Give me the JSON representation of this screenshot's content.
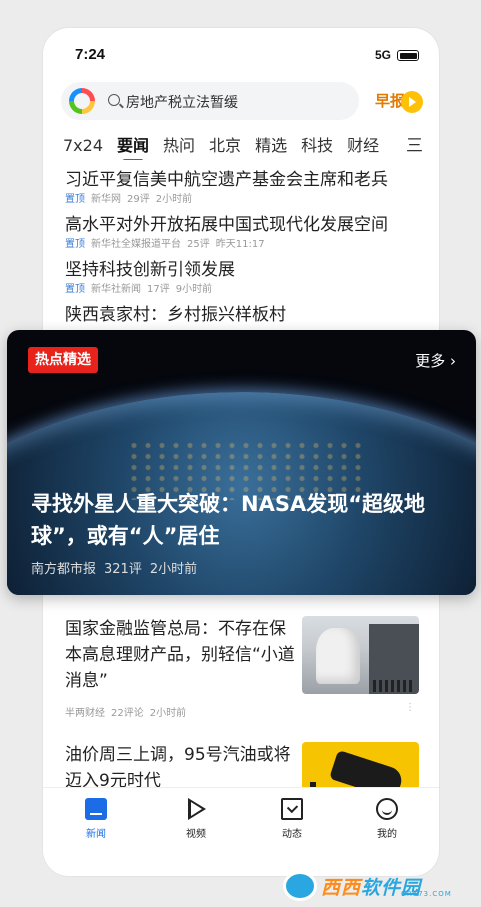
{
  "status_bar": {
    "time": "7:24",
    "network": "5G"
  },
  "search": {
    "query": "房地产税立法暂缓",
    "zaobao_label": "早报"
  },
  "tabs": [
    "7x24",
    "要闻",
    "热问",
    "北京",
    "精选",
    "科技",
    "财经"
  ],
  "active_tab": "要闻",
  "tab_menu_glyph": "三",
  "news": [
    {
      "title": "习近平复信美中航空遗产基金会主席和老兵",
      "pin": "置顶",
      "source": "新华网",
      "comments": "29评",
      "time": "2小时前"
    },
    {
      "title": "高水平对外开放拓展中国式现代化发展空间",
      "pin": "置顶",
      "source": "新华社全媒报道平台",
      "comments": "25评",
      "time": "昨天11:17"
    },
    {
      "title": "坚持科技创新引领发展",
      "pin": "置顶",
      "source": "新华社新闻",
      "comments": "17评",
      "time": "9小时前"
    },
    {
      "title": "陕西袁家村：乡村振兴样板村",
      "pin": "",
      "source": "",
      "comments": "",
      "time": ""
    }
  ],
  "hot_card": {
    "badge": "热点精选",
    "more": "更多 ›",
    "title": "寻找外星人重大突破：NASA发现“超级地球”，或有“人”居住",
    "source": "南方都市报",
    "comments": "321评",
    "time": "2小时前"
  },
  "articles": [
    {
      "title": "国家金融监管总局：不存在保本高息理财产品，别轻信“小道消息”",
      "source": "半两财经",
      "comments": "22评论",
      "time": "2小时前",
      "more": "⋮"
    },
    {
      "title": "油价周三上调，95号汽油或将迈入9元时代",
      "source": "",
      "comments": "",
      "time": "",
      "more": ""
    }
  ],
  "bottom_nav": [
    {
      "label": "新闻",
      "icon": "news-icon",
      "active": true
    },
    {
      "label": "视频",
      "icon": "video-icon",
      "active": false
    },
    {
      "label": "动态",
      "icon": "feed-icon",
      "active": false
    },
    {
      "label": "我的",
      "icon": "profile-icon",
      "active": false
    }
  ],
  "watermark": {
    "brand_a": "西西",
    "brand_b": "软件园",
    "url": "CR173.COM"
  },
  "colors": {
    "accent": "#1c6ce8",
    "hot_badge": "#e8231c",
    "zaobao": "#e07a00"
  }
}
